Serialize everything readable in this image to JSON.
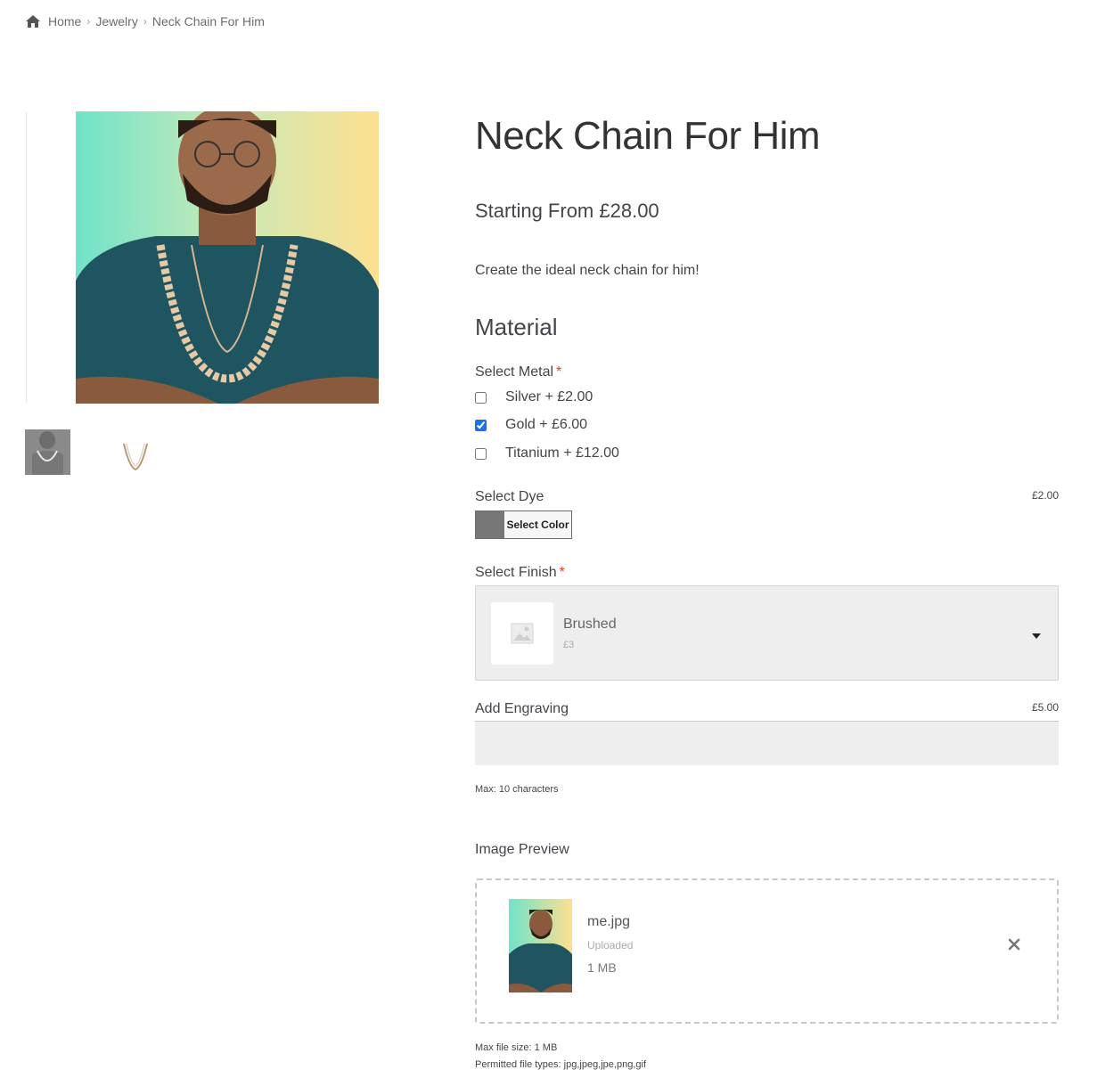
{
  "breadcrumb": {
    "home": "Home",
    "category": "Jewelry",
    "current": "Neck Chain For Him",
    "separator": "›"
  },
  "product": {
    "title": "Neck Chain For Him",
    "price": "Starting From £28.00",
    "description": "Create the ideal neck chain for him!"
  },
  "section": {
    "title": "Material"
  },
  "metal": {
    "label": "Select Metal",
    "required_mark": "*",
    "options": [
      {
        "label": "Silver + £2.00",
        "checked": false
      },
      {
        "label": "Gold + £6.00",
        "checked": true
      },
      {
        "label": "Titanium + £12.00",
        "checked": false
      }
    ]
  },
  "dye": {
    "label": "Select Dye",
    "price": "£2.00",
    "button_label": "Select Color",
    "swatch_color": "#777777"
  },
  "finish": {
    "label": "Select Finish",
    "required_mark": "*",
    "selected_name": "Brushed",
    "selected_price": "£3"
  },
  "engraving": {
    "label": "Add Engraving",
    "price": "£5.00",
    "value": "",
    "hint": "Max: 10 characters"
  },
  "image_preview": {
    "label": "Image Preview",
    "file_name": "me.jpg",
    "status": "Uploaded",
    "size": "1 MB",
    "max_size_text": "Max file size: 1 MB",
    "types_text": "Permitted file types: jpg,jpeg,jpe,png,gif"
  },
  "icons": {
    "home": "home-icon",
    "caret": "caret-down-icon",
    "remove": "close-icon",
    "placeholder": "image-placeholder-icon"
  },
  "colors": {
    "accent": "#1a73e8",
    "required": "#e2401c",
    "text": "#43454b"
  }
}
